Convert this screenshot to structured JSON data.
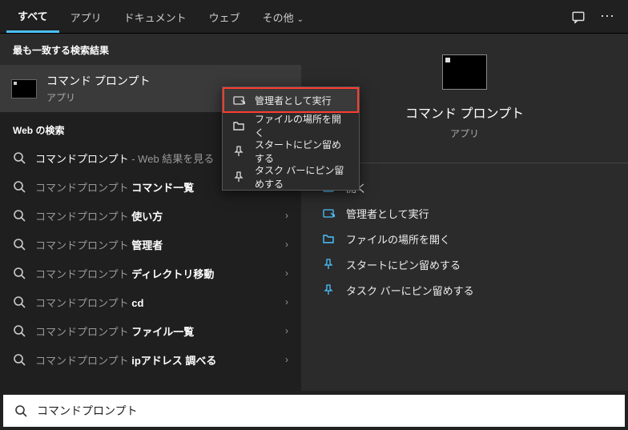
{
  "tabs": {
    "all": "すべて",
    "apps": "アプリ",
    "documents": "ドキュメント",
    "web": "ウェブ",
    "more": "その他"
  },
  "left": {
    "bestMatchHeader": "最も一致する検索結果",
    "bestMatch": {
      "title": "コマンド プロンプト",
      "subtitle": "アプリ"
    },
    "webHeader": "Web の検索",
    "suggestions": [
      {
        "prefix": "コマンドプロンプト",
        "bold": "",
        "tail": " - Web 結果を見る",
        "hasChevron": true
      },
      {
        "prefix": "コマンドプロンプト ",
        "bold": "コマンド一覧",
        "tail": "",
        "hasChevron": true
      },
      {
        "prefix": "コマンドプロンプト ",
        "bold": "使い方",
        "tail": "",
        "hasChevron": true
      },
      {
        "prefix": "コマンドプロンプト ",
        "bold": "管理者",
        "tail": "",
        "hasChevron": true
      },
      {
        "prefix": "コマンドプロンプト ",
        "bold": "ディレクトリ移動",
        "tail": "",
        "hasChevron": true
      },
      {
        "prefix": "コマンドプロンプト ",
        "bold": "cd",
        "tail": "",
        "hasChevron": true
      },
      {
        "prefix": "コマンドプロンプト ",
        "bold": "ファイル一覧",
        "tail": "",
        "hasChevron": true
      },
      {
        "prefix": "コマンドプロンプト ",
        "bold": "ipアドレス 調べる",
        "tail": "",
        "hasChevron": true
      }
    ]
  },
  "right": {
    "title": "コマンド プロンプト",
    "subtitle": "アプリ",
    "actions": {
      "open": "開く",
      "runAdmin": "管理者として実行",
      "openLocation": "ファイルの場所を開く",
      "pinStart": "スタートにピン留めする",
      "pinTaskbar": "タスク バーにピン留めする"
    }
  },
  "context": {
    "runAdmin": "管理者として実行",
    "openLocation": "ファイルの場所を開く",
    "pinStart": "スタートにピン留めする",
    "pinTaskbar": "タスク バーにピン留めする"
  },
  "searchValue": "コマンドプロンプト"
}
